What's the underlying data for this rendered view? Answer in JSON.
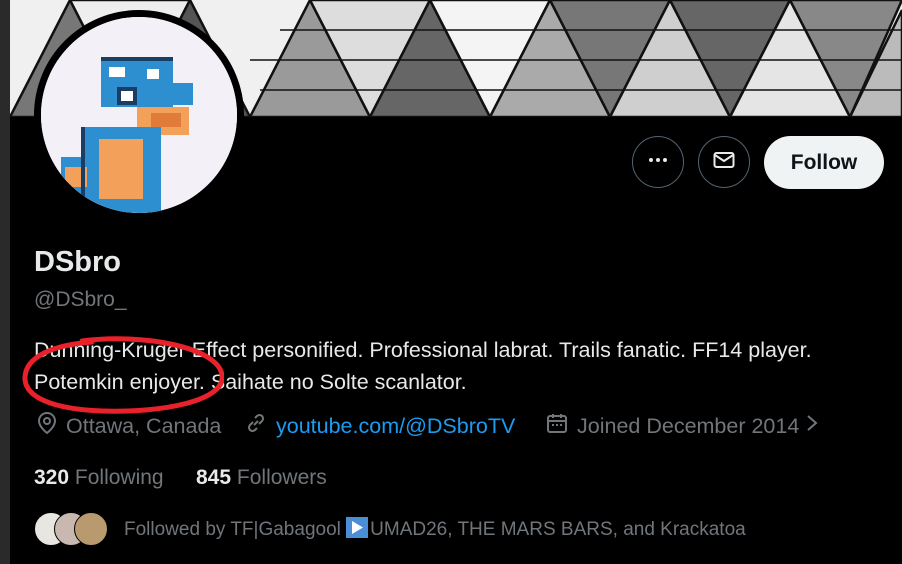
{
  "profile": {
    "name": "DSbro",
    "handle": "@DSbro_",
    "bio_line1": "Dunning-Kruger Effect personified. Professional labrat. Trails fanatic. FF14 player.",
    "bio_line2": "Potemkin enjoyer. Saihate no Solte scanlator.",
    "location": "Ottawa, Canada",
    "website": "youtube.com/@DSbroTV",
    "joined": "Joined December 2014"
  },
  "actions": {
    "follow_label": "Follow"
  },
  "stats": {
    "following_count": "320",
    "following_label": "Following",
    "followers_count": "845",
    "followers_label": "Followers"
  },
  "followed_by": {
    "prefix": "Followed by TF|Gabagool ",
    "rest": "UMAD26, THE MARS BARS, and Krackatoa"
  },
  "colors": {
    "background": "#000000",
    "link": "#1d9bf0",
    "follow_button_bg": "#eff3f4",
    "annotation": "#e8212a"
  },
  "icons": [
    "more-icon",
    "mail-icon",
    "location-icon",
    "link-icon",
    "calendar-icon",
    "chevron-right-icon"
  ]
}
